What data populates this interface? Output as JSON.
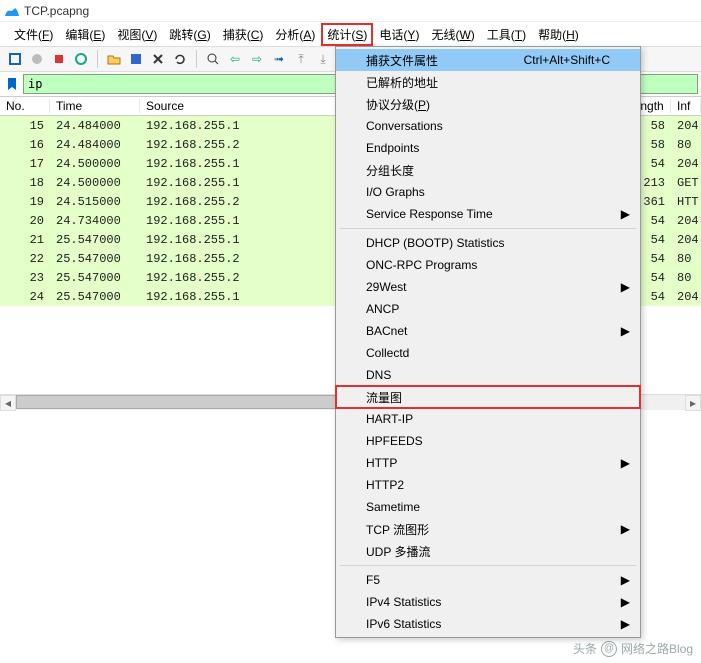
{
  "title": "TCP.pcapng",
  "menubar": [
    "文件(F)",
    "编辑(E)",
    "视图(V)",
    "跳转(G)",
    "捕获(C)",
    "分析(A)",
    "统计(S)",
    "电话(Y)",
    "无线(W)",
    "工具(T)",
    "帮助(H)"
  ],
  "menubar_open_index": 6,
  "filter": {
    "value": "ip"
  },
  "columns": {
    "no": "No.",
    "time": "Time",
    "src": "Source",
    "len": "Length",
    "inf": "Inf"
  },
  "rows": [
    {
      "no": "15",
      "time": "24.484000",
      "src": "192.168.255.1",
      "len": "58",
      "inf": "204"
    },
    {
      "no": "16",
      "time": "24.484000",
      "src": "192.168.255.2",
      "len": "58",
      "inf": "80"
    },
    {
      "no": "17",
      "time": "24.500000",
      "src": "192.168.255.1",
      "len": "54",
      "inf": "204"
    },
    {
      "no": "18",
      "time": "24.500000",
      "src": "192.168.255.1",
      "len": "213",
      "inf": "GET"
    },
    {
      "no": "19",
      "time": "24.515000",
      "src": "192.168.255.2",
      "len": "361",
      "inf": "HTT"
    },
    {
      "no": "20",
      "time": "24.734000",
      "src": "192.168.255.1",
      "len": "54",
      "inf": "204"
    },
    {
      "no": "21",
      "time": "25.547000",
      "src": "192.168.255.1",
      "len": "54",
      "inf": "204"
    },
    {
      "no": "22",
      "time": "25.547000",
      "src": "192.168.255.2",
      "len": "54",
      "inf": "80"
    },
    {
      "no": "23",
      "time": "25.547000",
      "src": "192.168.255.2",
      "len": "54",
      "inf": "80"
    },
    {
      "no": "24",
      "time": "25.547000",
      "src": "192.168.255.1",
      "len": "54",
      "inf": "204"
    }
  ],
  "dropdown": [
    {
      "label": "捕获文件属性",
      "kbd": "Ctrl+Alt+Shift+C",
      "hl": true
    },
    {
      "label": "已解析的地址"
    },
    {
      "label": "协议分级(P)"
    },
    {
      "label": "Conversations"
    },
    {
      "label": "Endpoints"
    },
    {
      "label": "分组长度"
    },
    {
      "label": "I/O Graphs"
    },
    {
      "label": "Service Response Time",
      "sub": true
    },
    {
      "sep": true
    },
    {
      "label": "DHCP (BOOTP) Statistics"
    },
    {
      "label": "ONC-RPC Programs"
    },
    {
      "label": "29West",
      "sub": true
    },
    {
      "label": "ANCP"
    },
    {
      "label": "BACnet",
      "sub": true
    },
    {
      "label": "Collectd"
    },
    {
      "label": "DNS"
    },
    {
      "label": "流量图",
      "boxed": true
    },
    {
      "label": "HART-IP"
    },
    {
      "label": "HPFEEDS"
    },
    {
      "label": "HTTP",
      "sub": true
    },
    {
      "label": "HTTP2"
    },
    {
      "label": "Sametime"
    },
    {
      "label": "TCP 流图形",
      "sub": true
    },
    {
      "label": "UDP 多播流"
    },
    {
      "sep": true
    },
    {
      "label": "F5",
      "sub": true
    },
    {
      "label": "IPv4 Statistics",
      "sub": true
    },
    {
      "label": "IPv6 Statistics",
      "sub": true
    }
  ],
  "watermark": {
    "prefix": "头条",
    "author": "网络之路Blog"
  }
}
